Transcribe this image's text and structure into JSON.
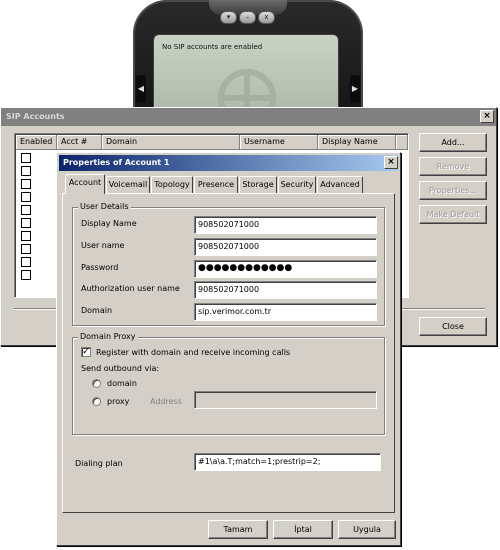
{
  "phone": {
    "screen_message": "No SIP accounts are enabled",
    "top_buttons": [
      "menu-down-icon",
      "minimize-icon",
      "close-icon"
    ],
    "left_button": "left-arrow-icon",
    "right_button": "right-arrow-icon"
  },
  "sip_accounts": {
    "title": "SIP Accounts",
    "columns": [
      "Enabled",
      "Acct #",
      "Domain",
      "Username",
      "Display Name"
    ],
    "row_count": 10,
    "buttons": {
      "add": "Add...",
      "remove": "Remove",
      "properties": "Properties...",
      "make_default": "Make Default",
      "close": "Close"
    }
  },
  "properties": {
    "title": "Properties of Account 1",
    "tabs": [
      "Account",
      "Voicemail",
      "Topology",
      "Presence",
      "Storage",
      "Security",
      "Advanced"
    ],
    "active_tab": "Account",
    "user_details": {
      "legend": "User Details",
      "display_name_label": "Display Name",
      "display_name": "908502071000",
      "user_name_label": "User name",
      "user_name": "908502071000",
      "password_label": "Password",
      "password": "●●●●●●●●●●●●",
      "auth_user_label": "Authorization user name",
      "auth_user": "908502071000",
      "domain_label": "Domain",
      "domain": "sip.verimor.com.tr"
    },
    "domain_proxy": {
      "legend": "Domain Proxy",
      "register_label": "Register with domain and receive incoming calls",
      "register_checked": true,
      "send_outbound_label": "Send outbound via:",
      "option_domain": "domain",
      "option_proxy": "proxy",
      "address_label": "Address",
      "address_value": ""
    },
    "dialing_plan_label": "Dialing plan",
    "dialing_plan": "#1\\a\\a.T;match=1;prestrip=2;",
    "buttons": {
      "ok": "Tamam",
      "cancel": "İptal",
      "apply": "Uygula"
    }
  }
}
